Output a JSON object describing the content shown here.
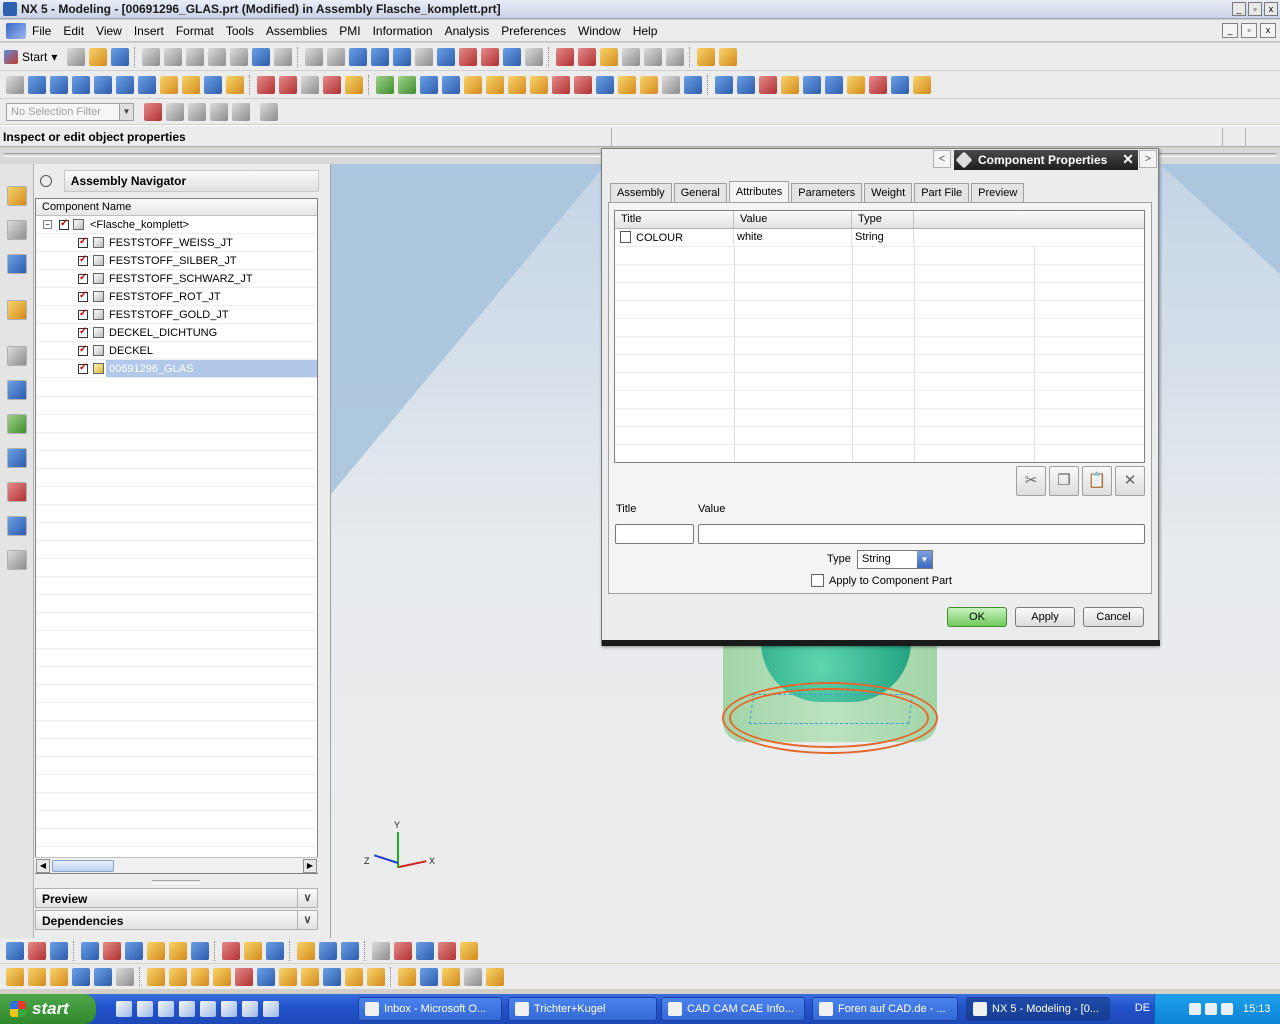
{
  "window": {
    "title": "NX 5 - Modeling - [00691296_GLAS.prt (Modified)  in Assembly Flasche_komplett.prt]",
    "controls": [
      "_",
      "▫",
      "x"
    ]
  },
  "menubar": {
    "items": [
      "File",
      "Edit",
      "View",
      "Insert",
      "Format",
      "Tools",
      "Assemblies",
      "PMI",
      "Information",
      "Analysis",
      "Preferences",
      "Window",
      "Help"
    ]
  },
  "toolbar": {
    "start_label": "Start",
    "selection_filter_placeholder": "No Selection Filter"
  },
  "cue_line": "Inspect or edit object properties",
  "navigator": {
    "title": "Assembly Navigator",
    "column_header": "Component Name",
    "root": "<Flasche_komplett>",
    "items": [
      "FESTSTOFF_WEISS_JT",
      "FESTSTOFF_SILBER_JT",
      "FESTSTOFF_SCHWARZ_JT",
      "FESTSTOFF_ROT_JT",
      "FESTSTOFF_GOLD_JT",
      "DECKEL_DICHTUNG",
      "DECKEL",
      "00691296_GLAS"
    ],
    "selected": "00691296_GLAS",
    "panels": [
      "Preview",
      "Dependencies"
    ]
  },
  "triad": {
    "x": "X",
    "y": "Y",
    "z": "Z"
  },
  "dialog": {
    "title": "Component Properties",
    "tabs": [
      "Assembly",
      "General",
      "Attributes",
      "Parameters",
      "Weight",
      "Part File",
      "Preview"
    ],
    "active_tab": "Attributes",
    "table": {
      "headers": [
        "Title",
        "Value",
        "Type"
      ],
      "rows": [
        {
          "title": "COLOUR",
          "value": "white",
          "type": "String"
        }
      ]
    },
    "title_label": "Title",
    "value_label": "Value",
    "type_label": "Type",
    "type_value": "String",
    "apply_to_component_label": "Apply to Component Part",
    "buttons": {
      "ok": "OK",
      "apply": "Apply",
      "cancel": "Cancel"
    }
  },
  "taskbar": {
    "start_label": "start",
    "tasks": [
      "Inbox - Microsoft O...",
      "Trichter+Kugel",
      "CAD CAM CAE Info...",
      "Foren auf CAD.de - ...",
      "NX 5 - Modeling - [0..."
    ],
    "language": "DE",
    "clock": "15:13"
  },
  "colors": {
    "accent": "#2253cc",
    "selection": "#b1c8ea",
    "ok_button": "#72c85e"
  }
}
